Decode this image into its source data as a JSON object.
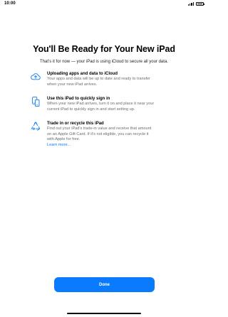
{
  "status_bar": {
    "time": "10:00",
    "signal_icon": "cellular-signal-icon",
    "battery_icon": "battery-icon"
  },
  "header": {
    "title": "You'll Be Ready for Your New iPad",
    "subtitle": "That's it for now — your iPad is using iCloud to secure all your data."
  },
  "features": [
    {
      "icon": "icloud-upload-icon",
      "title": "Uploading apps and data to iCloud",
      "desc_lines": [
        "Your apps and data will be up to date and ready to transfer",
        "when your new iPad arrives."
      ]
    },
    {
      "icon": "two-devices-icon",
      "title": "Use this iPad to quickly sign in",
      "desc_lines": [
        "When your new iPad arrives, turn it on and place it near your",
        "current iPad to quickly sign in and start setting up."
      ]
    },
    {
      "icon": "recycle-icon",
      "title": "Trade in or recycle this iPad",
      "desc_lines": [
        "Find out your iPad's trade-in value and receive that amount",
        "on an Apple Gift Card. If it's not eligible, you can recycle it",
        "with Apple for free."
      ],
      "link": "Learn more..."
    }
  ],
  "actions": {
    "done_label": "Done"
  },
  "colors": {
    "accent": "#0a7aff",
    "secondary_text": "#6c6c70",
    "background": "#ffffff"
  }
}
